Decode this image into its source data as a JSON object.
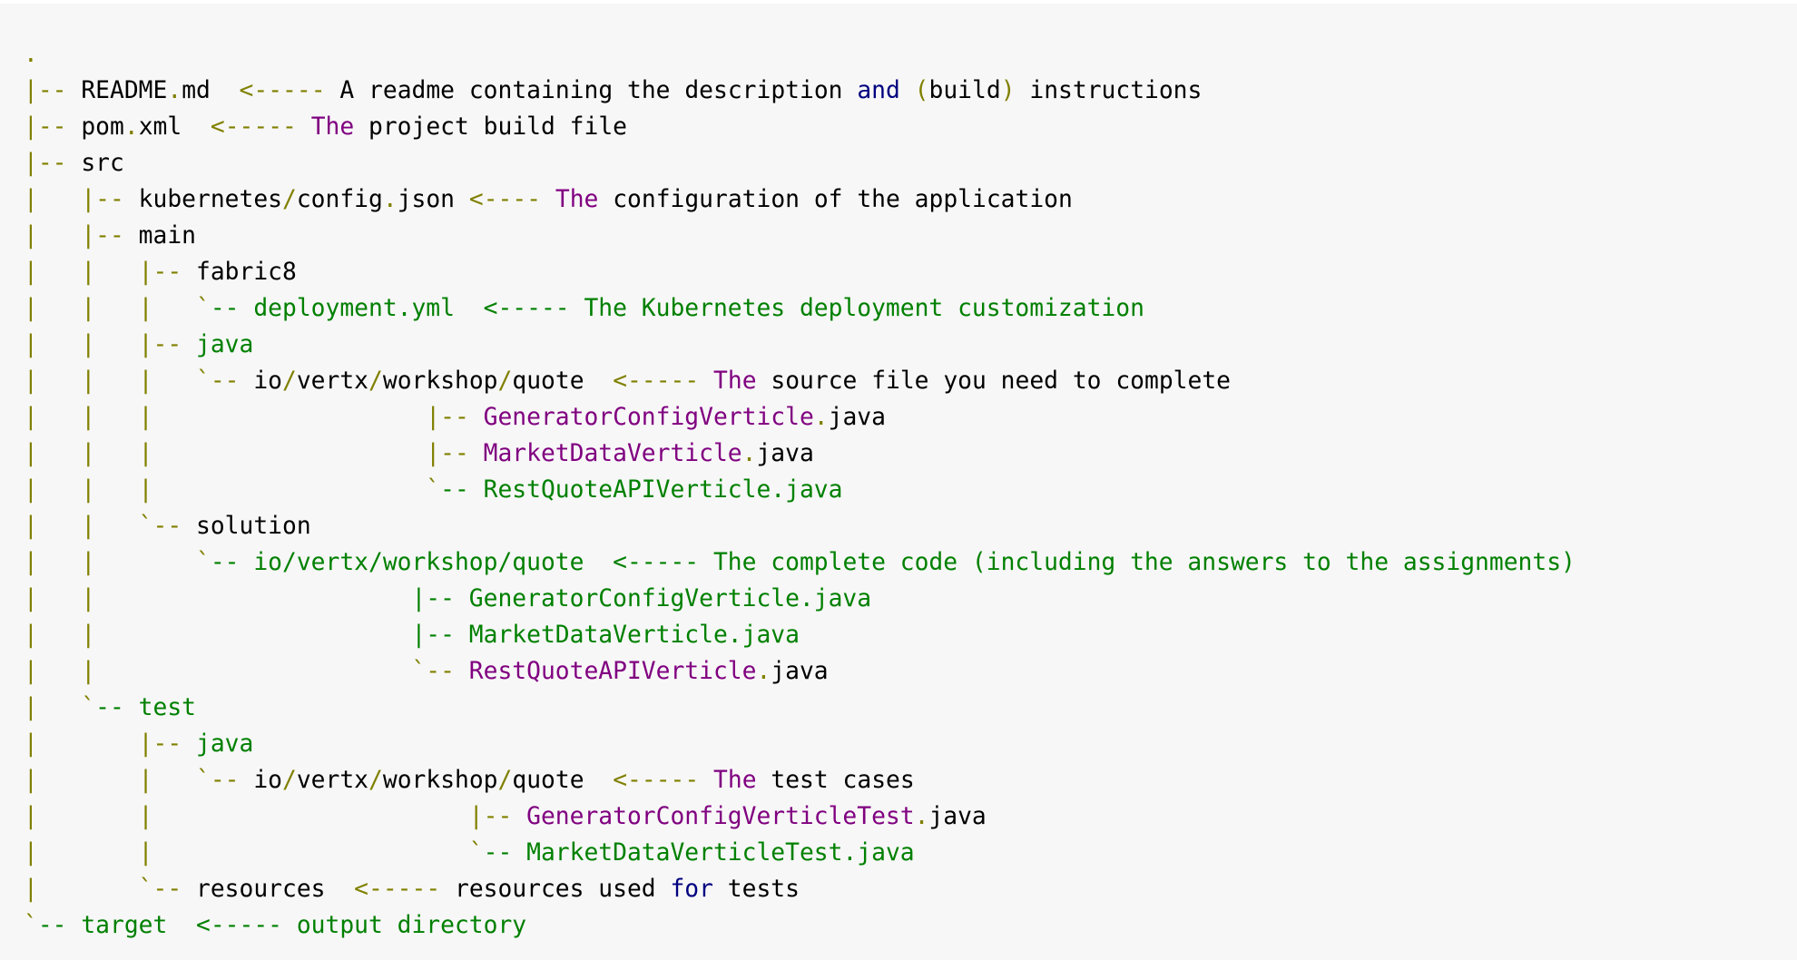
{
  "colors": {
    "background": "#f7f7f7",
    "text": "#000000",
    "punctuation": "#808000",
    "keyword_purple": "#800080",
    "string_green": "#008000",
    "keyword_navy": "#000080"
  },
  "tree_lines": [
    [
      {
        "t": ".",
        "c": "olive"
      }
    ],
    [
      {
        "t": "|-- ",
        "c": "olive"
      },
      {
        "t": "README",
        "c": "black"
      },
      {
        "t": ".",
        "c": "olive"
      },
      {
        "t": "md  ",
        "c": "black"
      },
      {
        "t": "<----- ",
        "c": "olive"
      },
      {
        "t": "A readme containing the description ",
        "c": "black"
      },
      {
        "t": "and",
        "c": "navy"
      },
      {
        "t": " ",
        "c": "black"
      },
      {
        "t": "(",
        "c": "olive"
      },
      {
        "t": "build",
        "c": "black"
      },
      {
        "t": ")",
        "c": "olive"
      },
      {
        "t": " instructions",
        "c": "black"
      }
    ],
    [
      {
        "t": "|-- ",
        "c": "olive"
      },
      {
        "t": "pom",
        "c": "black"
      },
      {
        "t": ".",
        "c": "olive"
      },
      {
        "t": "xml  ",
        "c": "black"
      },
      {
        "t": "<----- ",
        "c": "olive"
      },
      {
        "t": "The",
        "c": "purple"
      },
      {
        "t": " project build file",
        "c": "black"
      }
    ],
    [
      {
        "t": "|-- ",
        "c": "olive"
      },
      {
        "t": "src",
        "c": "black"
      }
    ],
    [
      {
        "t": "|   |-- ",
        "c": "olive"
      },
      {
        "t": "kubernetes",
        "c": "black"
      },
      {
        "t": "/",
        "c": "olive"
      },
      {
        "t": "config",
        "c": "black"
      },
      {
        "t": ".",
        "c": "olive"
      },
      {
        "t": "json ",
        "c": "black"
      },
      {
        "t": "<---- ",
        "c": "olive"
      },
      {
        "t": "The",
        "c": "purple"
      },
      {
        "t": " configuration of the application",
        "c": "black"
      }
    ],
    [
      {
        "t": "|   |-- ",
        "c": "olive"
      },
      {
        "t": "main",
        "c": "black"
      }
    ],
    [
      {
        "t": "|   |   |-- ",
        "c": "olive"
      },
      {
        "t": "fabric8",
        "c": "black"
      }
    ],
    [
      {
        "t": "|   |   |   `",
        "c": "olive"
      },
      {
        "t": "-- deployment.yml  <----- The Kubernetes deployment customization",
        "c": "green"
      }
    ],
    [
      {
        "t": "|   |   |-- ",
        "c": "olive"
      },
      {
        "t": "java",
        "c": "green"
      }
    ],
    [
      {
        "t": "|   |   |   `-- ",
        "c": "olive"
      },
      {
        "t": "io",
        "c": "black"
      },
      {
        "t": "/",
        "c": "olive"
      },
      {
        "t": "vertx",
        "c": "black"
      },
      {
        "t": "/",
        "c": "olive"
      },
      {
        "t": "workshop",
        "c": "black"
      },
      {
        "t": "/",
        "c": "olive"
      },
      {
        "t": "quote  ",
        "c": "black"
      },
      {
        "t": "<----- ",
        "c": "olive"
      },
      {
        "t": "The",
        "c": "purple"
      },
      {
        "t": " source file you need to complete",
        "c": "black"
      }
    ],
    [
      {
        "t": "|   |   |                   |-- ",
        "c": "olive"
      },
      {
        "t": "GeneratorConfigVerticle",
        "c": "purple"
      },
      {
        "t": ".",
        "c": "olive"
      },
      {
        "t": "java",
        "c": "black"
      }
    ],
    [
      {
        "t": "|   |   |                   |-- ",
        "c": "olive"
      },
      {
        "t": "MarketDataVerticle",
        "c": "purple"
      },
      {
        "t": ".",
        "c": "olive"
      },
      {
        "t": "java",
        "c": "black"
      }
    ],
    [
      {
        "t": "|   |   |                   `",
        "c": "olive"
      },
      {
        "t": "-- RestQuoteAPIVerticle.java",
        "c": "green"
      }
    ],
    [
      {
        "t": "|   |   `-- ",
        "c": "olive"
      },
      {
        "t": "solution",
        "c": "black"
      }
    ],
    [
      {
        "t": "|   |       `",
        "c": "olive"
      },
      {
        "t": "-- io/vertx/workshop/quote  <----- The complete code (including the answers to the assignments)",
        "c": "green"
      }
    ],
    [
      {
        "t": "|   |                      ",
        "c": "olive"
      },
      {
        "t": "|-- GeneratorConfigVerticle.java",
        "c": "green"
      }
    ],
    [
      {
        "t": "|   |                      ",
        "c": "olive"
      },
      {
        "t": "|-- MarketDataVerticle.java",
        "c": "green"
      }
    ],
    [
      {
        "t": "|   |                      `-- ",
        "c": "olive"
      },
      {
        "t": "RestQuoteAPIVerticle",
        "c": "purple"
      },
      {
        "t": ".",
        "c": "olive"
      },
      {
        "t": "java",
        "c": "black"
      }
    ],
    [
      {
        "t": "|   `",
        "c": "olive"
      },
      {
        "t": "-- test",
        "c": "green"
      }
    ],
    [
      {
        "t": "|       |-- ",
        "c": "olive"
      },
      {
        "t": "java",
        "c": "green"
      }
    ],
    [
      {
        "t": "|       |   `-- ",
        "c": "olive"
      },
      {
        "t": "io",
        "c": "black"
      },
      {
        "t": "/",
        "c": "olive"
      },
      {
        "t": "vertx",
        "c": "black"
      },
      {
        "t": "/",
        "c": "olive"
      },
      {
        "t": "workshop",
        "c": "black"
      },
      {
        "t": "/",
        "c": "olive"
      },
      {
        "t": "quote  ",
        "c": "black"
      },
      {
        "t": "<----- ",
        "c": "olive"
      },
      {
        "t": "The",
        "c": "purple"
      },
      {
        "t": " test cases",
        "c": "black"
      }
    ],
    [
      {
        "t": "|       |                      |-- ",
        "c": "olive"
      },
      {
        "t": "GeneratorConfigVerticleTest",
        "c": "purple"
      },
      {
        "t": ".",
        "c": "olive"
      },
      {
        "t": "java",
        "c": "black"
      }
    ],
    [
      {
        "t": "|       |                      `",
        "c": "olive"
      },
      {
        "t": "-- MarketDataVerticleTest.java",
        "c": "green"
      }
    ],
    [
      {
        "t": "|       `-- ",
        "c": "olive"
      },
      {
        "t": "resources  ",
        "c": "black"
      },
      {
        "t": "<----- ",
        "c": "olive"
      },
      {
        "t": "resources used ",
        "c": "black"
      },
      {
        "t": "for",
        "c": "navy"
      },
      {
        "t": " tests",
        "c": "black"
      }
    ],
    [
      {
        "t": "`",
        "c": "olive"
      },
      {
        "t": "-- target  <----- output directory",
        "c": "green"
      }
    ]
  ]
}
